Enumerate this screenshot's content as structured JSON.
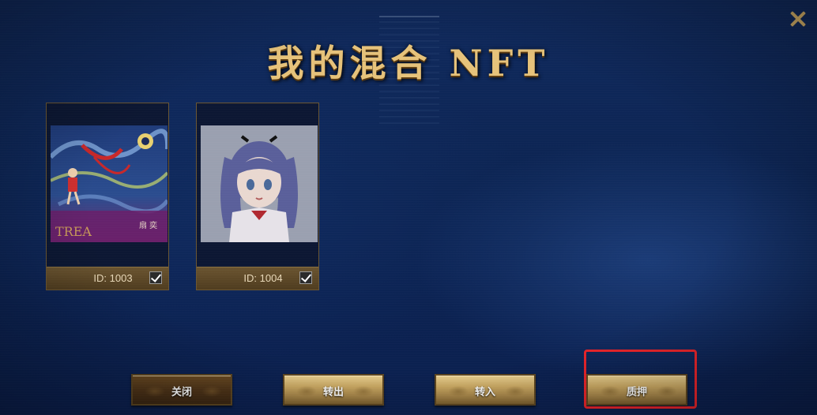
{
  "title": "我的混合 NFT",
  "cards": [
    {
      "id_label": "ID: 1003",
      "checked": true,
      "art_text": "TREA",
      "art_sub": "扇 奕"
    },
    {
      "id_label": "ID: 1004",
      "checked": true
    }
  ],
  "buttons": {
    "close": "关闭",
    "transfer_out": "转出",
    "transfer_in": "转入",
    "stake": "质押"
  },
  "colors": {
    "accent_gold": "#e6c27a",
    "highlight_red": "#e8242a",
    "bg_blue": "#0c2452"
  }
}
